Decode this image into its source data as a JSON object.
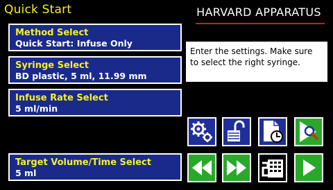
{
  "header": {
    "title": "Quick Start",
    "brand": "HARVARD APPARATUS"
  },
  "panels": [
    {
      "label": "Method Select",
      "value": "Quick Start: Infuse Only"
    },
    {
      "label": "Syringe Select",
      "value": "BD plastic, 5 ml, 11.99 mm"
    },
    {
      "label": "Infuse Rate Select",
      "value": "5 ml/min"
    },
    {
      "label": "Target Volume/Time Select",
      "value": "5 ml"
    }
  ],
  "info": {
    "text": "Enter the settings.  Make sure to select the right syringe."
  },
  "icons": {
    "row1": [
      "gears-icon",
      "unlock-icon",
      "document-clock-icon",
      "search-icon"
    ],
    "row2": [
      "rewind-icon",
      "fast-forward-icon",
      "method-flow-icon",
      "play-icon"
    ]
  },
  "colors": {
    "title": "#f6ef2a",
    "panel_bg": "#1a2a8a",
    "button_blue": "#1f2f9a",
    "button_green": "#2aa82a",
    "brand_line": "#d01d26"
  }
}
